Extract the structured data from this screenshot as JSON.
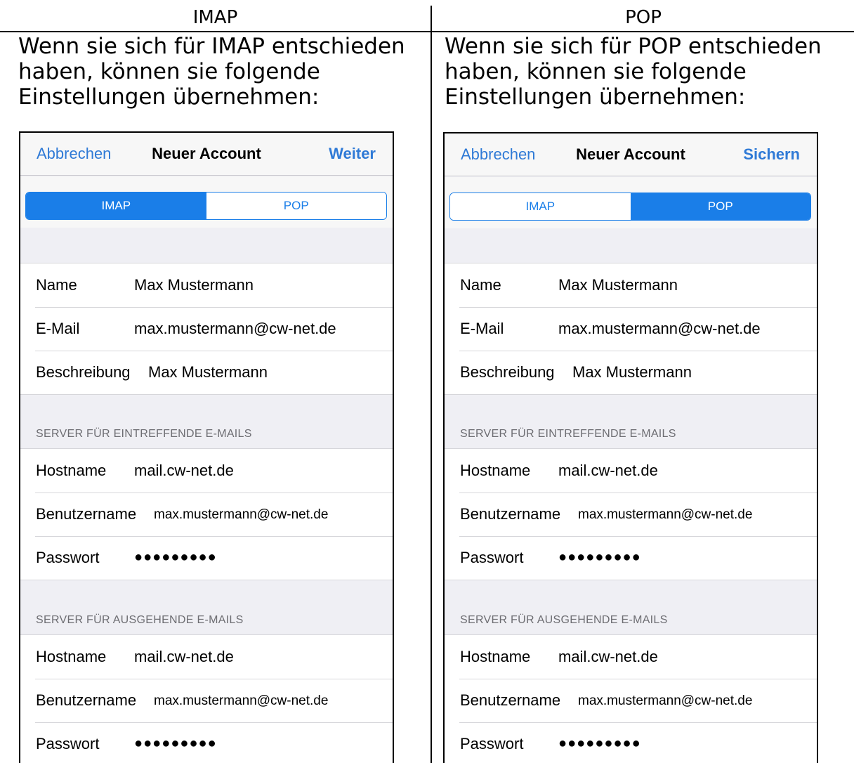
{
  "left": {
    "heading": "IMAP",
    "intro": [
      "Wenn sie sich für IMAP entschieden",
      "haben, können sie folgende",
      "Einstellungen übernehmen:"
    ],
    "phone": {
      "nav": {
        "cancel": "Abbrechen",
        "title": "Neuer Account",
        "action": "Weiter"
      },
      "segments": {
        "items": [
          "IMAP",
          "POP"
        ],
        "selected": "IMAP"
      },
      "account": [
        {
          "label": "Name",
          "value": "Max Mustermann"
        },
        {
          "label": "E-Mail",
          "value": "max.mustermann@cw-net.de"
        },
        {
          "label": "Beschreibung",
          "value": "Max Mustermann"
        }
      ],
      "incoming_header": "SERVER FÜR EINTREFFENDE E-MAILS",
      "incoming": [
        {
          "label": "Hostname",
          "value": "mail.cw-net.de"
        },
        {
          "label": "Benutzername",
          "value": "max.mustermann@cw-net.de"
        },
        {
          "label": "Passwort",
          "value": "●●●●●●●●●"
        }
      ],
      "outgoing_header": "SERVER FÜR AUSGEHENDE E-MAILS",
      "outgoing": [
        {
          "label": "Hostname",
          "value": "mail.cw-net.de"
        },
        {
          "label": "Benutzername",
          "value": "max.mustermann@cw-net.de"
        },
        {
          "label": "Passwort",
          "value": "●●●●●●●●●"
        }
      ]
    }
  },
  "right": {
    "heading": "POP",
    "intro": [
      "Wenn sie sich für POP entschieden",
      "haben, können sie folgende",
      "Einstellungen übernehmen:"
    ],
    "phone": {
      "nav": {
        "cancel": "Abbrechen",
        "title": "Neuer Account",
        "action": "Sichern"
      },
      "segments": {
        "items": [
          "IMAP",
          "POP"
        ],
        "selected": "POP"
      },
      "account": [
        {
          "label": "Name",
          "value": "Max Mustermann"
        },
        {
          "label": "E-Mail",
          "value": "max.mustermann@cw-net.de"
        },
        {
          "label": "Beschreibung",
          "value": "Max Mustermann"
        }
      ],
      "incoming_header": "SERVER FÜR EINTREFFENDE E-MAILS",
      "incoming": [
        {
          "label": "Hostname",
          "value": "mail.cw-net.de"
        },
        {
          "label": "Benutzername",
          "value": "max.mustermann@cw-net.de"
        },
        {
          "label": "Passwort",
          "value": "●●●●●●●●●"
        }
      ],
      "outgoing_header": "SERVER FÜR AUSGEHENDE E-MAILS",
      "outgoing": [
        {
          "label": "Hostname",
          "value": "mail.cw-net.de"
        },
        {
          "label": "Benutzername",
          "value": "max.mustermann@cw-net.de"
        },
        {
          "label": "Passwort",
          "value": "●●●●●●●●●"
        }
      ]
    }
  },
  "colors": {
    "ios_blue": "#1a7ee8",
    "link_blue": "#2f7ad6",
    "grouped_bg": "#efeff4",
    "section_text": "#6d6d72"
  }
}
